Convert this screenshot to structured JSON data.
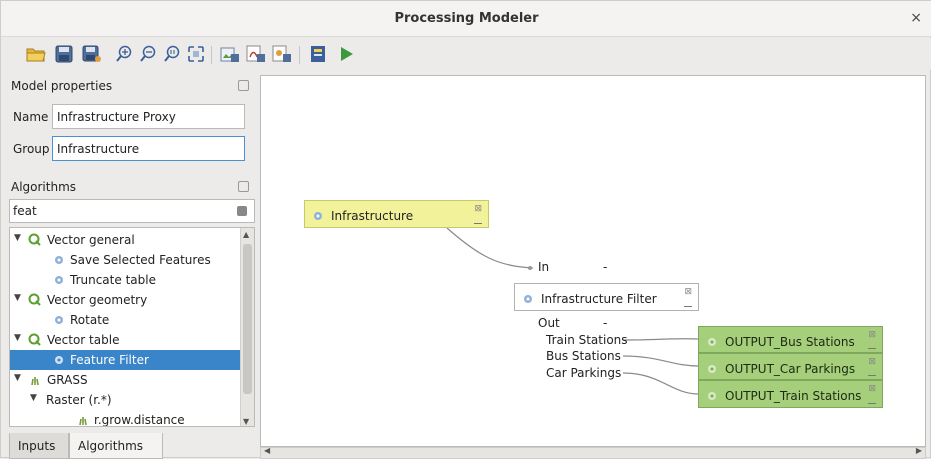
{
  "window": {
    "title": "Processing Modeler",
    "close_glyph": "×"
  },
  "toolbar": {
    "icons": [
      "open-icon",
      "save-icon",
      "save-as-icon",
      "zoom-in-icon",
      "zoom-out-icon",
      "zoom-actual-icon",
      "zoom-full-icon",
      "export-image-icon",
      "export-pdf-icon",
      "export-svg-icon",
      "export-python-icon",
      "run-icon"
    ]
  },
  "model_properties": {
    "header": "Model properties",
    "name_label": "Name",
    "name_value": "Infrastructure Proxy",
    "group_label": "Group",
    "group_value": "Infrastructure"
  },
  "algorithms": {
    "header": "Algorithms",
    "search_value": "feat",
    "tree": [
      {
        "label": "Vector general",
        "level": 0,
        "expanded": true,
        "type": "group"
      },
      {
        "label": "Save Selected Features",
        "level": 1,
        "type": "alg"
      },
      {
        "label": "Truncate table",
        "level": 1,
        "type": "alg"
      },
      {
        "label": "Vector geometry",
        "level": 0,
        "expanded": true,
        "type": "group"
      },
      {
        "label": "Rotate",
        "level": 1,
        "type": "alg"
      },
      {
        "label": "Vector table",
        "level": 0,
        "expanded": true,
        "type": "group"
      },
      {
        "label": "Feature Filter",
        "level": 1,
        "type": "alg",
        "selected": true
      },
      {
        "label": "GRASS",
        "level": 0,
        "expanded": true,
        "type": "grass"
      },
      {
        "label": "Raster (r.*)",
        "level": 1,
        "expanded": true,
        "type": "subgroup"
      },
      {
        "label": "r.grow.distance",
        "level": 2,
        "type": "grass-alg"
      }
    ]
  },
  "tabs": {
    "inputs": "Inputs",
    "algorithms": "Algorithms"
  },
  "canvas": {
    "input_node": "Infrastructure",
    "in_label": "In",
    "alg_node": "Infrastructure Filter",
    "out_label": "Out",
    "outputs": [
      "Train Stations",
      "Bus Stations",
      "Car Parkings"
    ],
    "output_nodes": [
      "OUTPUT_Bus Stations",
      "OUTPUT_Car Parkings",
      "OUTPUT_Train Stations"
    ],
    "minus_glyph": "-",
    "x_glyph": "⊠"
  },
  "colors": {
    "selection": "#3a84c9",
    "input_node": "#f2f29b",
    "output_node": "#a6cf7c",
    "run": "#3b9a3b"
  }
}
